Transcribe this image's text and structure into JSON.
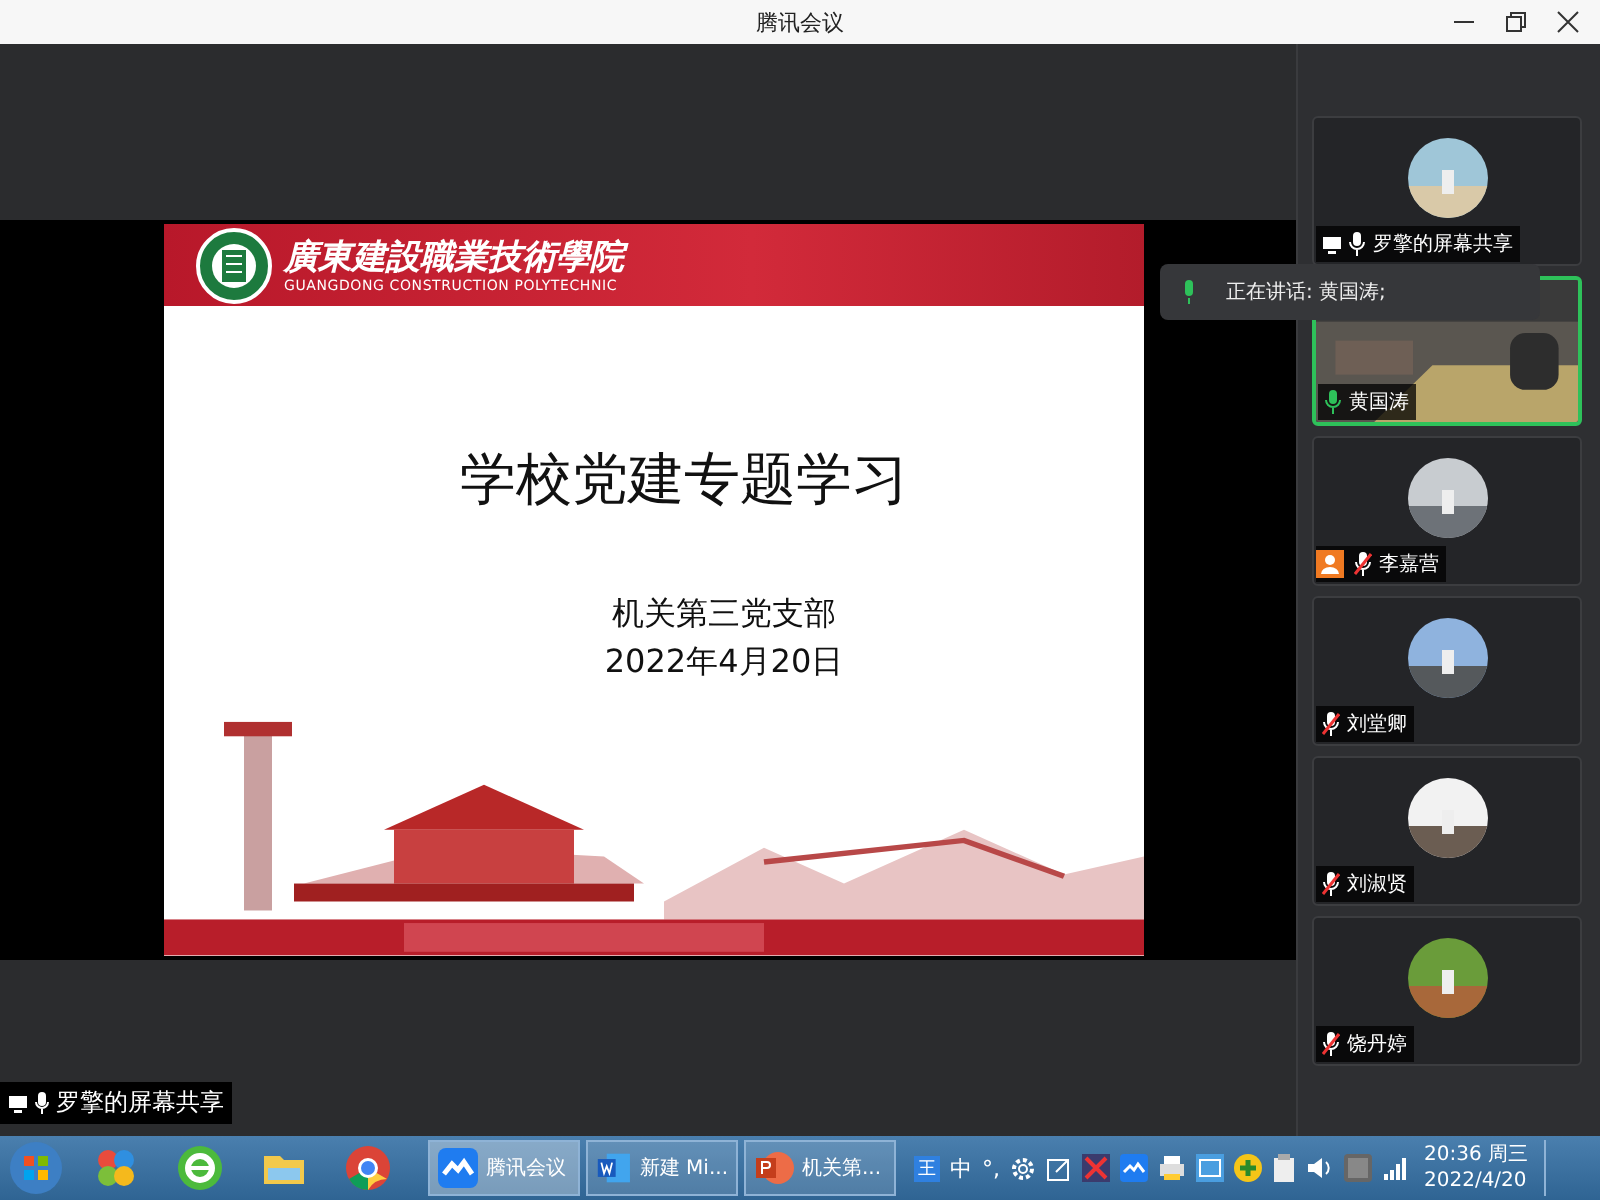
{
  "window": {
    "title": "腾讯会议"
  },
  "slide": {
    "school_name": "廣東建設職業技術學院",
    "school_name_en": "GUANGDONG CONSTRUCTION POLYTECHNIC",
    "title": "学校党建专题学习",
    "subtitle": "机关第三党支部",
    "date": "2022年4月20日"
  },
  "speaking_notice": {
    "text": "正在讲话: 黄国涛;"
  },
  "participants": [
    {
      "name": "罗擎的屏幕共享",
      "kind": "avatar",
      "sharing": true,
      "host": false,
      "muted": false,
      "speaking": false
    },
    {
      "name": "黄国涛",
      "kind": "video",
      "sharing": false,
      "host": false,
      "muted": false,
      "speaking": true
    },
    {
      "name": "李嘉营",
      "kind": "avatar",
      "sharing": false,
      "host": true,
      "muted": true,
      "speaking": false
    },
    {
      "name": "刘堂卿",
      "kind": "avatar",
      "sharing": false,
      "host": false,
      "muted": true,
      "speaking": false
    },
    {
      "name": "刘淑贤",
      "kind": "avatar",
      "sharing": false,
      "host": false,
      "muted": true,
      "speaking": false
    },
    {
      "name": "饶丹婷",
      "kind": "avatar",
      "sharing": false,
      "host": false,
      "muted": true,
      "speaking": false
    }
  ],
  "share_label": {
    "text": "罗擎的屏幕共享"
  },
  "taskbar": {
    "apps": [
      {
        "label": "腾讯会议",
        "selected": true,
        "kind": "meeting"
      },
      {
        "label": "新建 Mi...",
        "selected": false,
        "kind": "word"
      },
      {
        "label": "机关第...",
        "selected": false,
        "kind": "ppt"
      }
    ],
    "tray_texts": [
      "王",
      "中",
      "°,"
    ],
    "time": "20:36 周三",
    "date": "2022/4/20"
  }
}
